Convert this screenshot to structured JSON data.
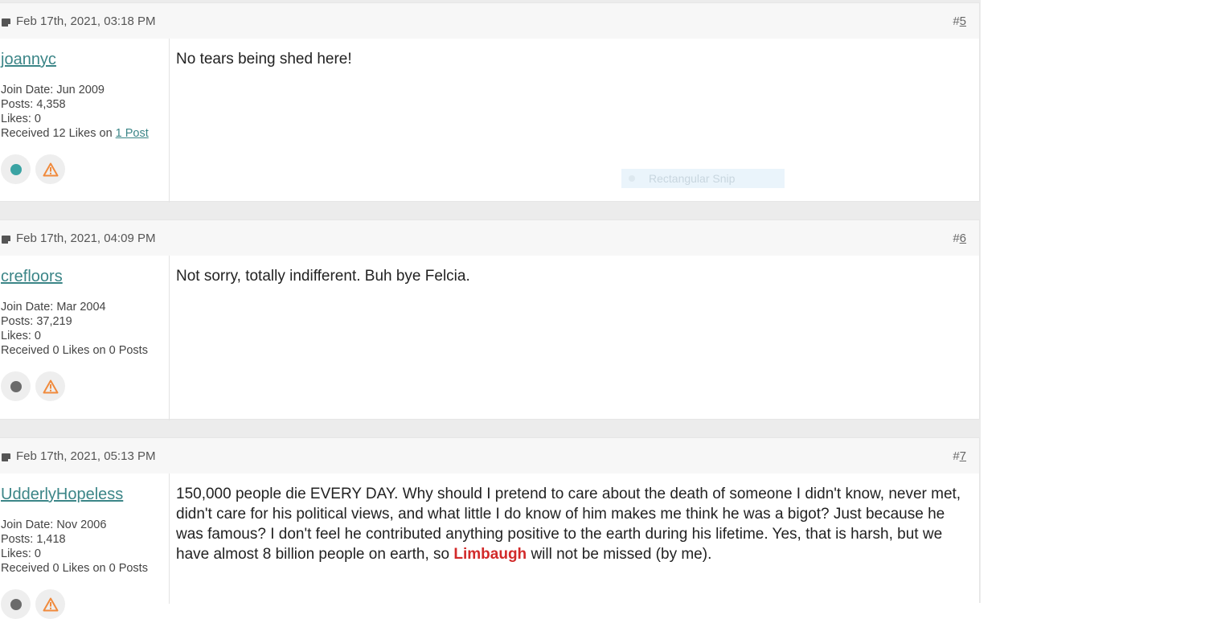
{
  "posts": [
    {
      "date": "Feb 17th, 2021, 03:18 PM",
      "num_hash": "#",
      "num": "5",
      "username": "joannyc",
      "join": "Join Date: Jun 2009",
      "posts": "Posts: 4,358",
      "likes": "Likes: 0",
      "received_prefix": "Received 12 Likes on ",
      "received_link": "1 Post",
      "status_color": "#3aa3a3",
      "body_parts": [
        "No tears being shed here!"
      ]
    },
    {
      "date": "Feb 17th, 2021, 04:09 PM",
      "num_hash": "#",
      "num": "6",
      "username": "crefloors",
      "join": "Join Date: Mar 2004",
      "posts": "Posts: 37,219",
      "likes": "Likes: 0",
      "received_prefix": "Received 0 Likes on 0 Posts",
      "received_link": "",
      "status_color": "#6b6b6b",
      "body_parts": [
        "Not sorry, totally indifferent. Buh bye Felcia."
      ]
    },
    {
      "date": "Feb 17th, 2021, 05:13 PM",
      "num_hash": "#",
      "num": "7",
      "username": "UdderlyHopeless",
      "join": "Join Date: Nov 2006",
      "posts": "Posts: 1,418",
      "likes": "Likes: 0",
      "received_prefix": "Received 0 Likes on 0 Posts",
      "received_link": "",
      "status_color": "#6b6b6b",
      "body_before": "150,000 people die EVERY DAY. Why should I pretend to care about the death of someone I didn't know, never met, didn't care for his political views, and what little I do know of him makes me think he was a bigot? Just because he was famous? I don't feel he contributed anything positive to the earth during his lifetime. Yes, that is harsh, but we have almost 8 billion people on earth, so ",
      "body_highlight": "Limbaugh",
      "body_after": " will not be missed (by me)."
    }
  ],
  "overlay": {
    "snip_label": "Rectangular Snip"
  },
  "colors": {
    "link": "#3b8587",
    "warning": "#f08a3c",
    "highlight": "#d22a2a"
  },
  "icons": [
    "document-icon",
    "status-dot-icon",
    "warning-icon"
  ]
}
